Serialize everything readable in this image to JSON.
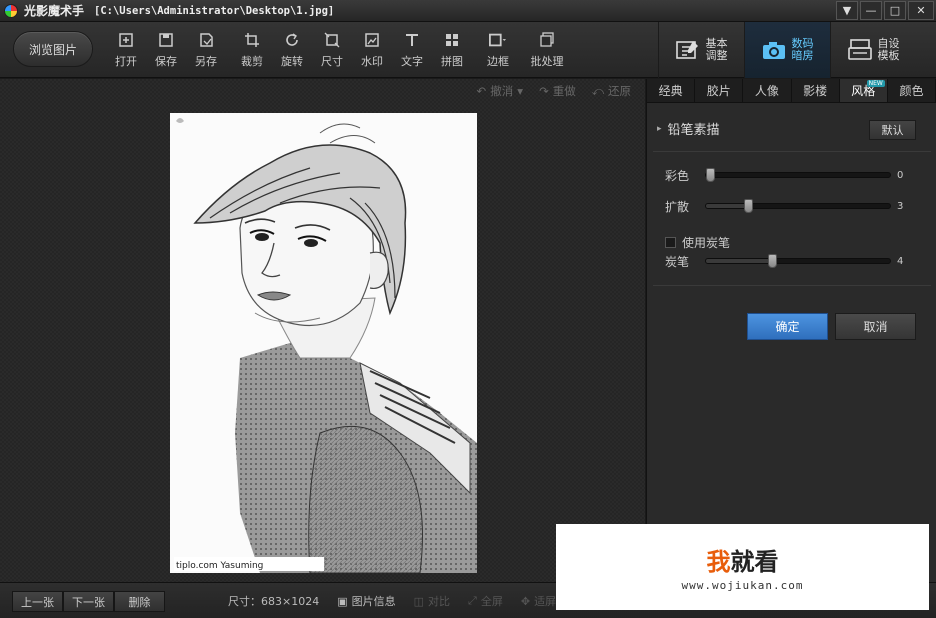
{
  "window": {
    "app_name": "光影魔术手",
    "file_path": "[C:\\Users\\Administrator\\Desktop\\1.jpg]",
    "buttons": [
      "▼",
      "—",
      "□",
      "✕"
    ]
  },
  "toolbar": {
    "browse_label": "浏览图片",
    "tools": [
      {
        "label": "打开",
        "icon": "open-icon"
      },
      {
        "label": "保存",
        "icon": "save-icon"
      },
      {
        "label": "另存",
        "icon": "save-as-icon"
      },
      {
        "label": "裁剪",
        "icon": "crop-icon"
      },
      {
        "label": "旋转",
        "icon": "rotate-icon"
      },
      {
        "label": "尺寸",
        "icon": "resize-icon"
      },
      {
        "label": "水印",
        "icon": "watermark-icon"
      },
      {
        "label": "文字",
        "icon": "text-icon"
      },
      {
        "label": "拼图",
        "icon": "collage-icon"
      },
      {
        "label": "边框",
        "icon": "border-icon"
      },
      {
        "label": "批处理",
        "icon": "batch-icon"
      }
    ],
    "mode_tabs": [
      {
        "line1": "基本",
        "line2": "调整",
        "icon": "basic-adjust-icon",
        "active": false
      },
      {
        "line1": "数码",
        "line2": "暗房",
        "icon": "camera-icon",
        "active": true
      },
      {
        "line1": "自设",
        "line2": "模板",
        "icon": "template-icon",
        "active": false
      }
    ]
  },
  "undo_bar": {
    "undo": "撤消",
    "redo": "重做",
    "restore": "还原"
  },
  "image": {
    "caption": "tiplo.com  Yasuming"
  },
  "panel": {
    "tabs": [
      {
        "label": "经典",
        "active": false
      },
      {
        "label": "胶片",
        "active": false
      },
      {
        "label": "人像",
        "active": false
      },
      {
        "label": "影楼",
        "active": false
      },
      {
        "label": "风格",
        "active": true,
        "badge": "NEW"
      },
      {
        "label": "颜色",
        "active": false
      }
    ],
    "effect_title": "铅笔素描",
    "default_label": "默认",
    "sliders": [
      {
        "label": "彩色",
        "value": 0,
        "fraction": 0.02
      },
      {
        "label": "扩散",
        "value": 3,
        "fraction": 0.23
      },
      {
        "label": "炭笔",
        "value": 4,
        "fraction": 0.36
      }
    ],
    "checkbox_label": "使用炭笔",
    "ok_label": "确定",
    "cancel_label": "取消"
  },
  "statusbar": {
    "prev": "上一张",
    "next": "下一张",
    "delete": "删除",
    "size": "尺寸：683×1024",
    "info": "图片信息",
    "compare": "对比",
    "fullscreen": "全屏",
    "fit": "适屏"
  },
  "watermark": {
    "title_a": "我",
    "title_b": "就看",
    "url": "www.wojiukan.com"
  }
}
